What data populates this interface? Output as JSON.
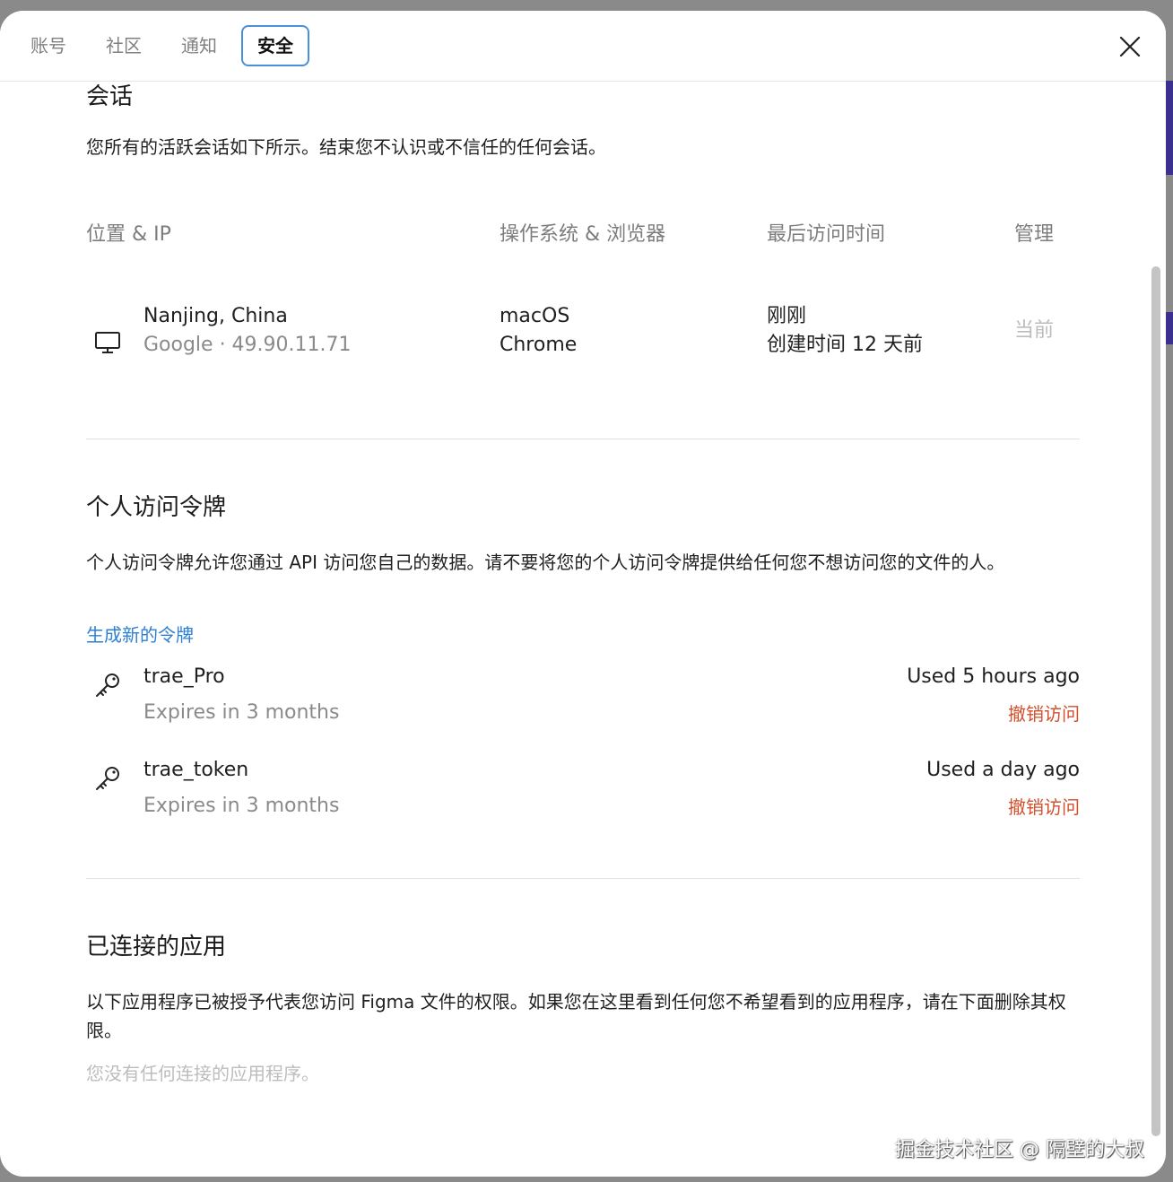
{
  "tabs": [
    {
      "label": "账号",
      "active": false
    },
    {
      "label": "社区",
      "active": false
    },
    {
      "label": "通知",
      "active": false
    },
    {
      "label": "安全",
      "active": true
    }
  ],
  "close_icon": "close-icon",
  "sessions": {
    "title": "会话",
    "description": "您所有的活跃会话如下所示。结束您不认识或不信任的任何会话。",
    "columns": [
      "位置 & IP",
      "操作系统 & 浏览器",
      "最后访问时间",
      "管理"
    ],
    "rows": [
      {
        "icon": "monitor-icon",
        "location": "Nanjing, China",
        "ip": "Google · 49.90.11.71",
        "os": "macOS",
        "browser": "Chrome",
        "last_access": "刚刚",
        "created": "创建时间 12 天前",
        "manage": "当前"
      }
    ]
  },
  "tokens": {
    "title": "个人访问令牌",
    "description": "个人访问令牌允许您通过 API 访问您自己的数据。请不要将您的个人访问令牌提供给任何您不想访问您的文件的人。",
    "generate_link": "生成新的令牌",
    "items": [
      {
        "icon": "key-icon",
        "name": "trae_Pro",
        "expires": "Expires in 3 months",
        "used": "Used 5 hours ago",
        "revoke": "撤销访问"
      },
      {
        "icon": "key-icon",
        "name": "trae_token",
        "expires": "Expires in 3 months",
        "used": "Used a day ago",
        "revoke": "撤销访问"
      }
    ]
  },
  "apps": {
    "title": "已连接的应用",
    "description": "以下应用程序已被授予代表您访问 Figma 文件的权限。如果您在这里看到任何您不希望看到的应用程序，请在下面删除其权限。",
    "empty": "您没有任何连接的应用程序。"
  },
  "watermark": "掘金技术社区 @ 隔壁的大叔",
  "colors": {
    "accent": "#2e7fd6",
    "danger": "#d2502d",
    "tab_border": "#4a8fdc"
  }
}
